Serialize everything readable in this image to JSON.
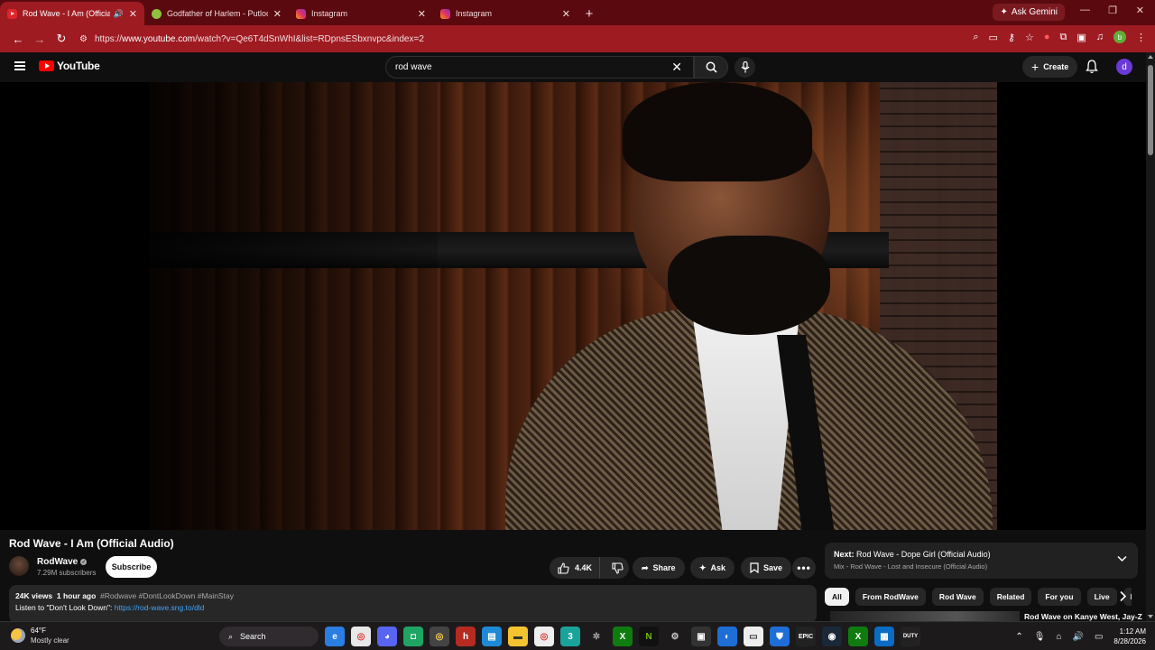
{
  "browser": {
    "tabs": [
      {
        "title": "Rod Wave - I Am (Official Au",
        "favicon": "youtube-icon",
        "active": true
      },
      {
        "title": "Godfather of Harlem - Putlocke",
        "favicon": "putlocker-icon",
        "active": false
      },
      {
        "title": "Instagram",
        "favicon": "instagram-icon",
        "active": false
      },
      {
        "title": "Instagram",
        "favicon": "instagram-icon",
        "active": false
      }
    ],
    "ask_gemini": "Ask Gemini",
    "url_prefix": "https://",
    "url_host": "www.youtube.com",
    "url_path": "/watch?v=Qe6T4dSnWhI&list=RDpnsESbxnvpc&index=2",
    "profile_initial": "b",
    "theme_color": "#9e1b22"
  },
  "youtube": {
    "logo_text": "YouTube",
    "search_value": "rod wave",
    "create_label": "Create",
    "avatar_initial": "d"
  },
  "video": {
    "title": "Rod Wave - I Am (Official Audio)",
    "channel": "RodWave",
    "subscribers": "7.29M subscribers",
    "subscribe_label": "Subscribe",
    "likes": "4.4K",
    "share_label": "Share",
    "ask_label": "Ask",
    "save_label": "Save",
    "views": "24K views",
    "age": "1 hour ago",
    "hashtags": "#Rodwave #DontLookDown #MainStay",
    "desc_line2_prefix": "Listen to \"Don't Look Down\": ",
    "desc_link": "https://rod-wave.sng.to/dld"
  },
  "playlist": {
    "next_label": "Next:",
    "next_title": "Rod Wave - Dope Girl (Official Audio)",
    "mix_title": "Mix - Rod Wave - Lost and Insecure (Official Audio)"
  },
  "chips": [
    "All",
    "From RodWave",
    "Rod Wave",
    "Related",
    "For you",
    "Live",
    "Rece"
  ],
  "recommendation": {
    "title": "Rod Wave on Kanye West, Jay-Z"
  },
  "taskbar": {
    "weather_temp": "64°F",
    "weather_desc": "Mostly clear",
    "search_label": "Search",
    "time": "1:12 AM",
    "date": "8/28/2026"
  }
}
